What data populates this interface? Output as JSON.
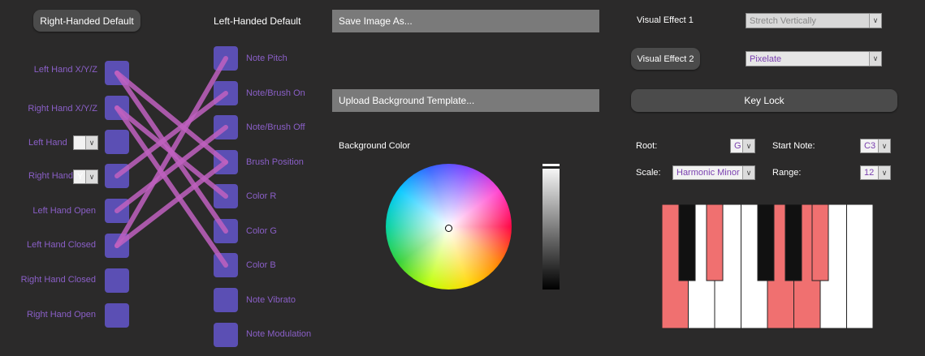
{
  "left_panel": {
    "right_default_label": "Right-Handed Default",
    "left_default_label": "Left-Handed Default",
    "inputs": [
      "Left Hand X/Y/Z",
      "Right Hand X/Y/Z",
      "Left Hand",
      "Right Hand",
      "Left Hand Open",
      "Left Hand Closed",
      "Right Hand Closed",
      "Right Hand Open"
    ],
    "left_hand_axis": "",
    "right_hand_axis": "Y",
    "outputs": [
      "Note Pitch",
      "Note/Brush On",
      "Note/Brush Off",
      "Brush Position",
      "Color R",
      "Color G",
      "Color B",
      "Note Vibrato",
      "Note Modulation"
    ]
  },
  "middle_panel": {
    "save_image": "Save Image As...",
    "upload_template": "Upload Background Template...",
    "background_color_label": "Background Color"
  },
  "right_panel": {
    "visual_effect_1_label": "Visual Effect 1",
    "visual_effect_1_value": "Stretch Vertically",
    "visual_effect_2_label": "Visual Effect 2",
    "visual_effect_2_value": "Pixelate",
    "key_lock": "Key Lock",
    "root_label": "Root:",
    "root_value": "G",
    "start_note_label": "Start Note:",
    "start_note_value": "C3",
    "scale_label": "Scale:",
    "scale_value": "Harmonic Minor",
    "range_label": "Range:",
    "range_value": "12"
  },
  "colors": {
    "accent_purple": "#8a5fc7",
    "node_blue": "#5b4fb4",
    "wire_pink": "#c060c0",
    "key_highlight": "#f07070"
  }
}
